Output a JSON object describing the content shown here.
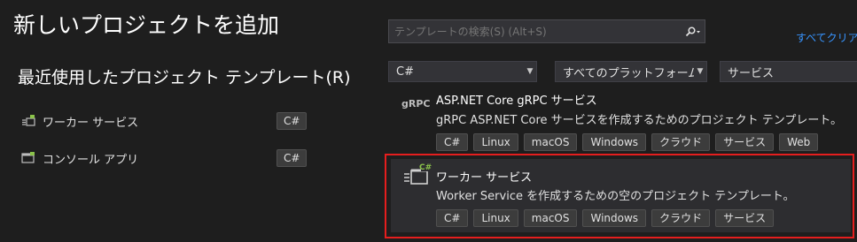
{
  "page": {
    "title": "新しいプロジェクトを追加",
    "recent_title": "最近使用したプロジェクト テンプレート(R)"
  },
  "recent": [
    {
      "label": "ワーカー サービス",
      "lang": "C#",
      "icon": "worker-service-icon"
    },
    {
      "label": "コンソール アプリ",
      "lang": "C#",
      "icon": "console-app-icon"
    }
  ],
  "search": {
    "placeholder": "テンプレートの検索(S) (Alt+S)",
    "clear_all": "すべてクリア(C)"
  },
  "filters": {
    "language": "C#",
    "platform": "すべてのプラットフォーム(…",
    "project_type": "サービス"
  },
  "templates": [
    {
      "icon_text": "gRPC",
      "title": "ASP.NET Core gRPC サービス",
      "description": "gRPC ASP.NET Core サービスを作成するためのプロジェクト テンプレート。",
      "tags": [
        "C#",
        "Linux",
        "macOS",
        "Windows",
        "クラウド",
        "サービス",
        "Web"
      ]
    },
    {
      "icon_badge": "C#",
      "title": "ワーカー サービス",
      "description": "Worker Service を作成するための空のプロジェクト テンプレート。",
      "tags": [
        "C#",
        "Linux",
        "macOS",
        "Windows",
        "クラウド",
        "サービス"
      ]
    }
  ],
  "colors": {
    "background": "#1e1e1e",
    "link": "#3794ff",
    "highlight_border": "#e51e1e",
    "csharp_green": "#8bc34a"
  }
}
